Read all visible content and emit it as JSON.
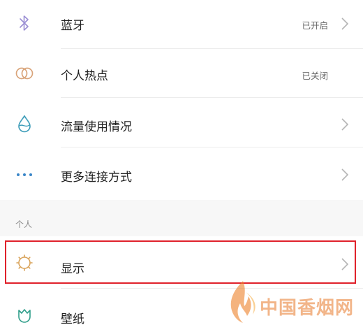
{
  "network_items": [
    {
      "label": "蓝牙",
      "status": "已开启",
      "icon": "bluetooth-icon"
    },
    {
      "label": "个人热点",
      "status": "已关闭",
      "icon": "hotspot-icon"
    },
    {
      "label": "流量使用情况",
      "status": "",
      "icon": "data-usage-icon"
    },
    {
      "label": "更多连接方式",
      "status": "",
      "icon": "more-dots-icon"
    }
  ],
  "personal_section": {
    "header": "个人",
    "items": [
      {
        "label": "显示",
        "icon": "display-sun-icon"
      },
      {
        "label": "壁纸",
        "icon": "wallpaper-tulip-icon"
      }
    ]
  },
  "watermark": {
    "text": "中国香烟网"
  },
  "colors": {
    "highlight": "#e0212b",
    "bluetooth_icon": "#9b8fd4",
    "hotspot_icon": "#d9a47a",
    "data_icon": "#3a9bb8",
    "more_icon": "#3a86c8",
    "display_icon": "#d9a35a",
    "wallpaper_icon": "#2f9e8a",
    "watermark": "#e8782a"
  }
}
